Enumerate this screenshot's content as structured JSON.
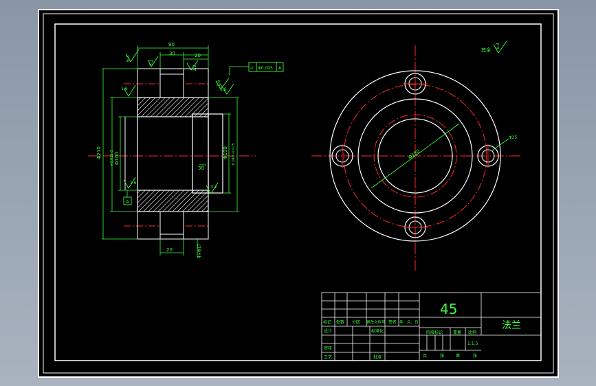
{
  "drawing": {
    "colors": {
      "background": "#000000",
      "outline": "#ffffff",
      "dimension": "#3cff3c",
      "centerline": "#ff2a2a",
      "hatch": "#ffffff"
    },
    "section_view": {
      "dims": {
        "overall_width": "90",
        "hub_width": "30",
        "step_width": "20",
        "bottom_width": "20",
        "inner_step": "30",
        "od_left": "Φ210",
        "bore_left": "Φ100",
        "bore_tol": "+0.015\n0",
        "od_right": "Φ100",
        "od_right_tol": "-0.040\n-0.075",
        "hole_dia": "4×Φ17"
      },
      "roughness": [
        "6.3",
        "3.2",
        "3.2",
        "1.6",
        "1.6",
        "1.6",
        "1.6",
        "3.2"
      ],
      "tolerance_frame": {
        "symbol": "⌭",
        "value": "Φ0.005",
        "datum": "A"
      },
      "datum_label": "A"
    },
    "front_view": {
      "pcd_label": "Φ180",
      "hole_label": "Φ25",
      "roughness_note": "其余",
      "roughness_value": "6.3"
    },
    "title_block": {
      "material": "45",
      "part_name": "法兰",
      "header_row": [
        "标记",
        "处数",
        "分区",
        "更改文件号",
        "签名",
        "年、月、日"
      ],
      "row_design": [
        "设计",
        "标准化"
      ],
      "row_check": "审核",
      "row_process": [
        "工艺",
        "批准"
      ],
      "stage_label": "阶段标记",
      "weight_label": "重量",
      "scale_label": "比例",
      "scale_value": "1:1.5",
      "sheet_row": [
        "共",
        "张",
        "第",
        "张"
      ]
    }
  }
}
